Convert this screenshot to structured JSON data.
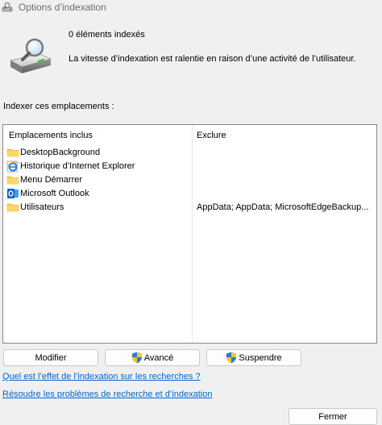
{
  "window": {
    "title": "Options d’indexation",
    "icon": "indexing-options-icon"
  },
  "summary": {
    "indexed_count_text": "0 éléments indexés",
    "status_text": "La vitesse d’indexation est ralentie en raison d’une activité de l’utilisateur."
  },
  "locations": {
    "section_label": "Indexer ces emplacements :",
    "columns": {
      "included": "Emplacements inclus",
      "exclude": "Exclure"
    },
    "rows": [
      {
        "name": "DesktopBackground",
        "exclude": "",
        "icon": "folder-icon"
      },
      {
        "name": "Historique d’Internet Explorer",
        "exclude": "",
        "icon": "internet-explorer-icon"
      },
      {
        "name": "Menu Démarrer",
        "exclude": "",
        "icon": "folder-icon"
      },
      {
        "name": "Microsoft Outlook",
        "exclude": "",
        "icon": "outlook-icon"
      },
      {
        "name": "Utilisateurs",
        "exclude": "AppData; AppData; MicrosoftEdgeBackup...",
        "icon": "folder-icon"
      }
    ]
  },
  "buttons": {
    "modify": "Modifier",
    "advanced": "Avancé",
    "pause": "Suspendre",
    "close": "Fermer"
  },
  "links": {
    "effect": "Quel est l’effet de l’indexation sur les recherches ?",
    "troubleshoot": "Résoudre les problèmes de recherche et d’indexation"
  },
  "colors": {
    "link": "#0066cc",
    "folder": "#f8c94a",
    "window_bg": "#f0f0f0"
  }
}
